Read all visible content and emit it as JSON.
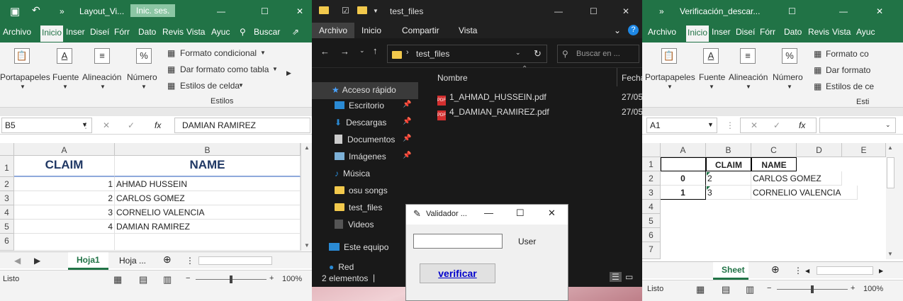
{
  "left_excel": {
    "title": "Layout_Vi...",
    "login": "Inic. ses.",
    "tabs": [
      "Archivo",
      "Inicio",
      "Inser",
      "Diseí",
      "Fórr",
      "Dato",
      "Revis",
      "Vista",
      "Ayuc"
    ],
    "search": "Buscar",
    "ribbon": {
      "clipboard": "Portapapeles",
      "font": "Fuente",
      "alignment": "Alineación",
      "number": "Número",
      "cond_format": "Formato condicional",
      "table_format": "Dar formato como tabla",
      "cell_styles": "Estilos de celda",
      "styles_group": "Estilos"
    },
    "name_box": "B5",
    "formula": "DAMIAN RAMIREZ",
    "fx": "fx",
    "col_headers": [
      "A",
      "B"
    ],
    "row_headers": [
      "1",
      "2",
      "3",
      "4",
      "5",
      "6"
    ],
    "header_row": [
      "CLAIM",
      "NAME"
    ],
    "rows": [
      [
        "1",
        "AHMAD HUSSEIN"
      ],
      [
        "2",
        "CARLOS GOMEZ"
      ],
      [
        "3",
        "CORNELIO VALENCIA"
      ],
      [
        "4",
        "DAMIAN RAMIREZ"
      ]
    ],
    "sheets": [
      "Hoja1",
      "Hoja ..."
    ],
    "status": "Listo",
    "zoom": "100%"
  },
  "explorer": {
    "title": "test_files",
    "menu": [
      "Archivo",
      "Inicio",
      "Compartir",
      "Vista"
    ],
    "path": "test_files",
    "search_placeholder": "Buscar en ...",
    "nav": [
      "Acceso rápido",
      "Escritorio",
      "Descargas",
      "Documentos",
      "Imágenes",
      "Música",
      "osu songs",
      "test_files",
      "Videos",
      "Este equipo",
      "Red"
    ],
    "col_name": "Nombre",
    "col_date": "Fecha",
    "files": [
      {
        "name": "1_AHMAD_HUSSEIN.pdf",
        "date": "27/05"
      },
      {
        "name": "4_DAMIAN_RAMIREZ.pdf",
        "date": "27/05"
      }
    ],
    "status": "2 elementos"
  },
  "right_excel": {
    "title": "Verificación_descar...",
    "tabs": [
      "Archivo",
      "Inicio",
      "Inser",
      "Diseí",
      "Fórr",
      "Dato",
      "Revis",
      "Vista",
      "Ayuc"
    ],
    "ribbon": {
      "clipboard": "Portapapeles",
      "font": "Fuente",
      "alignment": "Alineación",
      "number": "Número",
      "cond_format": "Formato co",
      "table_format": "Dar formato",
      "cell_styles": "Estilos de ce",
      "styles_group": "Esti"
    },
    "name_box": "A1",
    "fx": "fx",
    "col_headers": [
      "A",
      "B",
      "C",
      "D",
      "E"
    ],
    "row_headers": [
      "1",
      "2",
      "3",
      "4",
      "5",
      "6",
      "7"
    ],
    "header_row": [
      "",
      "CLAIM",
      "NAME"
    ],
    "rows": [
      [
        "0",
        "2",
        "CARLOS GOMEZ"
      ],
      [
        "1",
        "3",
        "CORNELIO VALENCIA"
      ]
    ],
    "sheet": "Sheet",
    "status": "Listo",
    "zoom": "100%"
  },
  "dialog": {
    "title": "Validador ...",
    "label": "User",
    "button": "verificar"
  }
}
